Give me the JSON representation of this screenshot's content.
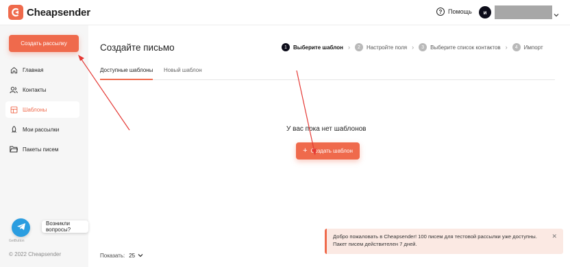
{
  "header": {
    "brand": "Cheapsender",
    "help_label": "Помощь",
    "avatar_initial": "и"
  },
  "sidebar": {
    "create_button": "Создать рассылку",
    "items": [
      {
        "label": "Главная",
        "icon": "home-icon"
      },
      {
        "label": "Контакты",
        "icon": "contacts-icon"
      },
      {
        "label": "Шаблоны",
        "icon": "templates-icon",
        "active": true
      },
      {
        "label": "Мои рассылки",
        "icon": "mailings-icon"
      },
      {
        "label": "Пакеты писем",
        "icon": "folder-icon"
      }
    ],
    "chat_prompt": "Возникли вопросы?",
    "getbutton": "GetButton",
    "copyright": "© 2022 Cheapsender"
  },
  "main": {
    "title": "Создайте письмо",
    "steps": [
      {
        "num": "1",
        "label": "Выберите шаблон",
        "current": true
      },
      {
        "num": "2",
        "label": "Настройте поля"
      },
      {
        "num": "3",
        "label": "Выберите список контактов"
      },
      {
        "num": "4",
        "label": "Импорт"
      }
    ],
    "tabs": [
      "Доступные шаблоны",
      "Новый шаблон"
    ],
    "empty_text": "У вас пока нет шаблонов",
    "create_template_button": "Создать шаблон",
    "pager": {
      "label": "Показать:",
      "value": "25"
    }
  },
  "toast": {
    "line1": "Добро пожаловать в Cheapsender! 100 писем для тестовой рассылки уже доступны.",
    "line2": "Пакет писем действителен 7 дней."
  },
  "colors": {
    "accent": "#ef6a4c",
    "sidebar_bg": "#f6f6f6",
    "toast_bg": "#fbe9e3",
    "annotation_arrow": "#e53935",
    "telegram": "#2a9de0"
  }
}
